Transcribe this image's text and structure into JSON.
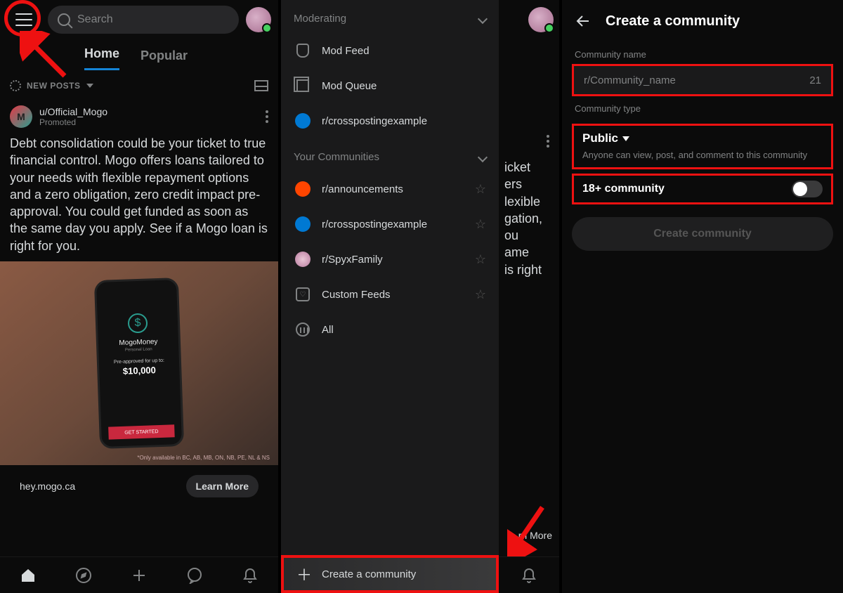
{
  "panel1": {
    "search_placeholder": "Search",
    "tabs": {
      "home": "Home",
      "popular": "Popular"
    },
    "feed_sort": "NEW POSTS",
    "post": {
      "avatar_letter": "M",
      "user": "u/Official_Mogo",
      "promo": "Promoted",
      "body": "Debt consolidation could be your ticket to true financial control. Mogo offers loans tailored to your needs with flexible repayment options and a zero obligation, zero credit impact pre-approval. You could get funded as soon as the same day you apply. See if a Mogo loan is right for you.",
      "phone_brand": "MogoMoney",
      "phone_sub": "Personal Loan",
      "phone_pre": "Pre-approved for up to:",
      "phone_amount": "$10,000",
      "phone_cta": "GET STARTED",
      "disclaimer": "*Only available in BC, AB, MB, ON, NB, PE, NL & NS",
      "link": "hey.mogo.ca",
      "learn": "Learn More"
    }
  },
  "panel2": {
    "moderating_label": "Moderating",
    "mod_items": {
      "feed": "Mod Feed",
      "queue": "Mod Queue",
      "cross": "r/crosspostingexample"
    },
    "your_label": "Your Communities",
    "communities": {
      "announcements": "r/announcements",
      "cross": "r/crosspostingexample",
      "spy": "r/SpyxFamily",
      "custom": "Custom Feeds",
      "all": "All"
    },
    "create": "Create a community",
    "partial_lines": "icket\ners\nlexible\ngation,\nou\name\nis right",
    "partial_learn": "rn More"
  },
  "panel3": {
    "title": "Create a community",
    "name_label": "Community name",
    "name_placeholder": "r/Community_name",
    "name_count": "21",
    "type_label": "Community type",
    "type_value": "Public",
    "type_desc": "Anyone can view, post, and comment to this community",
    "adult_label": "18+ community",
    "create_btn": "Create community"
  }
}
